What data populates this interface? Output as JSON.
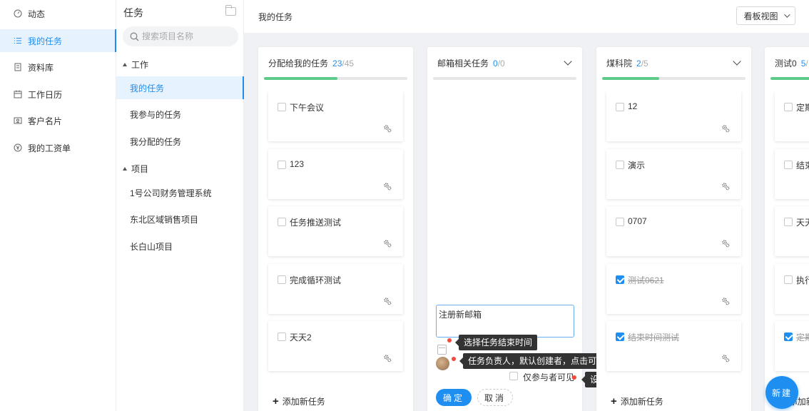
{
  "nav": {
    "items": [
      {
        "label": "动态",
        "icon": "dashboard-icon"
      },
      {
        "label": "我的任务",
        "icon": "list-icon",
        "active": true
      },
      {
        "label": "资料库",
        "icon": "file-icon"
      },
      {
        "label": "工作日历",
        "icon": "calendar-icon"
      },
      {
        "label": "客户名片",
        "icon": "contact-card-icon"
      },
      {
        "label": "我的工资单",
        "icon": "yen-icon"
      }
    ]
  },
  "side": {
    "title": "任务",
    "search_placeholder": "搜索项目名称",
    "groups": [
      {
        "label": "工作",
        "items": [
          {
            "label": "我的任务",
            "active": true
          },
          {
            "label": "我参与的任务"
          },
          {
            "label": "我分配的任务"
          }
        ]
      },
      {
        "label": "项目",
        "items": [
          {
            "label": "1号公司财务管理系统"
          },
          {
            "label": "东北区域销售项目"
          },
          {
            "label": "长白山项目"
          }
        ]
      }
    ]
  },
  "header": {
    "breadcrumb": "我的任务",
    "view_button": "看板视图"
  },
  "board": {
    "add_task_label": "添加新任务",
    "columns": [
      {
        "title": "分配给我的任务",
        "done": "23",
        "total": "/45",
        "progress": 0.51,
        "cards": [
          {
            "title": "下午会议",
            "checked": false
          },
          {
            "title": "123",
            "checked": false
          },
          {
            "title": "任务推送测试",
            "checked": false
          },
          {
            "title": "完成循环测试",
            "checked": false
          },
          {
            "title": "天天2",
            "checked": false
          }
        ]
      },
      {
        "title": "邮箱相关任务",
        "done": "0",
        "total": "/0",
        "progress": 0,
        "cards": []
      },
      {
        "title": "煤科院",
        "done": "2",
        "total": "/5",
        "progress": 0.4,
        "cards": [
          {
            "title": "12",
            "checked": false
          },
          {
            "title": "演示",
            "checked": false
          },
          {
            "title": "0707",
            "checked": false
          },
          {
            "title": "测试0621",
            "checked": true
          },
          {
            "title": "结束时间测试",
            "checked": true
          }
        ]
      },
      {
        "title": "测试0",
        "done": "5",
        "total": "/",
        "progress": 0.6,
        "cards": [
          {
            "title": "定期",
            "checked": false
          },
          {
            "title": "结束",
            "checked": false
          },
          {
            "title": "天天",
            "checked": false
          },
          {
            "title": "执行",
            "checked": false
          },
          {
            "title": "定期",
            "checked": true
          }
        ]
      }
    ]
  },
  "new_task_form": {
    "input_value": "注册新邮箱",
    "tip_end_time": "选择任务结束时间",
    "tip_owner": "任务负责人，默认创建者，点击可更换",
    "visible_label": "仅参与者可见",
    "tip_visible": "设置可见条件",
    "confirm": "确定",
    "cancel": "取消"
  },
  "fab_label": "新建",
  "colors": {
    "accent": "#1f8ef1",
    "progress": "#5ecb8a",
    "tip_dot": "#f24a3c"
  }
}
